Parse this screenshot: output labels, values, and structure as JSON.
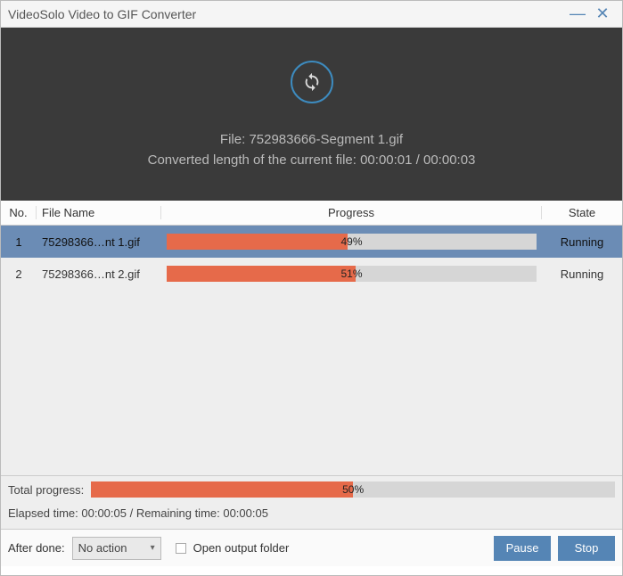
{
  "window": {
    "title": "VideoSolo Video to GIF Converter"
  },
  "preview": {
    "file_label": "File:",
    "file_name": "752983666-Segment 1.gif",
    "length_label": "Converted length of the current file:",
    "length_current": "00:00:01",
    "length_total": "00:00:03"
  },
  "columns": {
    "no": "No.",
    "name": "File Name",
    "progress": "Progress",
    "state": "State"
  },
  "rows": [
    {
      "no": "1",
      "name": "75298366…nt 1.gif",
      "percent": 49,
      "percent_label": "49%",
      "state": "Running",
      "selected": true
    },
    {
      "no": "2",
      "name": "75298366…nt 2.gif",
      "percent": 51,
      "percent_label": "51%",
      "state": "Running",
      "selected": false
    }
  ],
  "summary": {
    "total_label": "Total progress:",
    "total_percent": 50,
    "total_percent_label": "50%",
    "time_line": "Elapsed time: 00:00:05 / Remaining time: 00:00:05"
  },
  "footer": {
    "after_done_label": "After done:",
    "after_done_value": "No action",
    "open_output_label": "Open output folder",
    "open_output_checked": false,
    "pause": "Pause",
    "stop": "Stop"
  }
}
